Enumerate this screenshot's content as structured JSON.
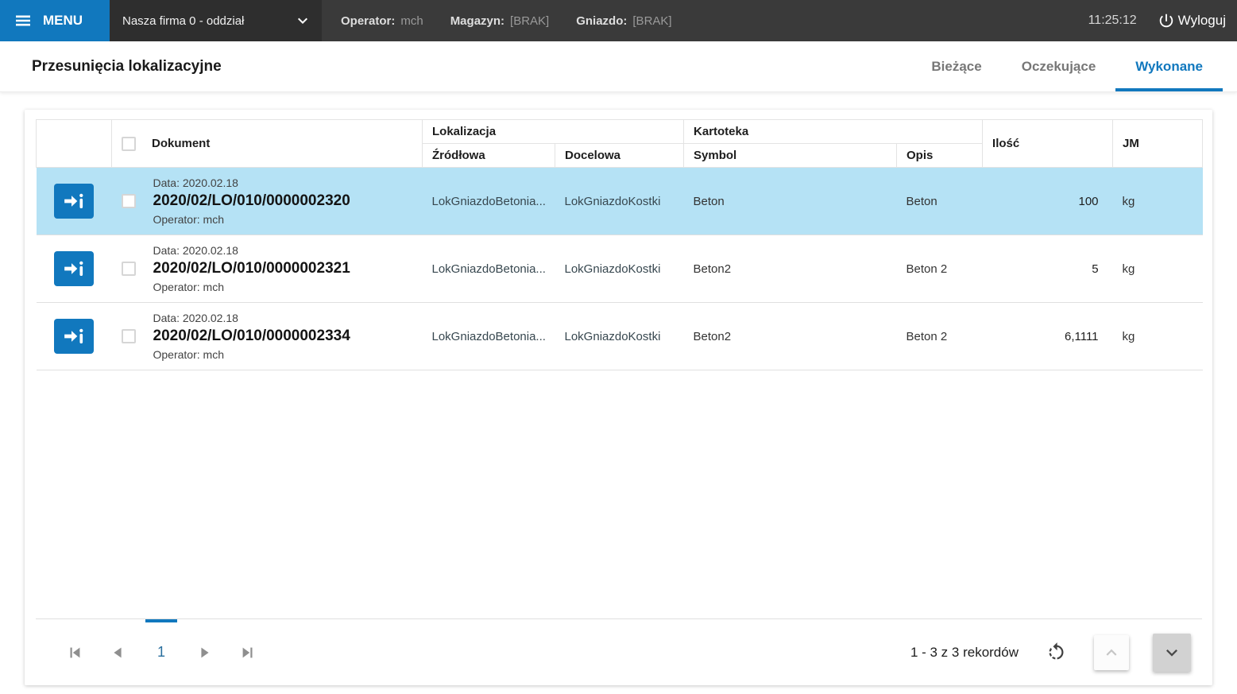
{
  "topbar": {
    "menu_label": "MENU",
    "company": "Nasza firma 0 - oddział",
    "operator_label": "Operator:",
    "operator_value": "mch",
    "magazyn_label": "Magazyn:",
    "magazyn_value": "[BRAK]",
    "gniazdo_label": "Gniazdo:",
    "gniazdo_value": "[BRAK]",
    "time": "11:25:12",
    "logout_label": "Wyloguj"
  },
  "header": {
    "title": "Przesunięcia lokalizacyjne",
    "tabs": [
      {
        "label": "Bieżące",
        "active": false
      },
      {
        "label": "Oczekujące",
        "active": false
      },
      {
        "label": "Wykonane",
        "active": true
      }
    ]
  },
  "table": {
    "headers": {
      "dokument": "Dokument",
      "lokalizacja": "Lokalizacja",
      "zrodlowa": "Źródłowa",
      "docelowa": "Docelowa",
      "kartoteka": "Kartoteka",
      "symbol": "Symbol",
      "opis": "Opis",
      "ilosc": "Ilość",
      "jm": "JM"
    },
    "rows": [
      {
        "date_line": "Data: 2020.02.18",
        "document": "2020/02/LO/010/0000002320",
        "operator_line": "Operator: mch",
        "zrodlowa": "LokGniazdoBetonia...",
        "docelowa": "LokGniazdoKostki",
        "symbol": "Beton",
        "opis": "Beton",
        "ilosc": "100",
        "jm": "kg",
        "selected": true
      },
      {
        "date_line": "Data: 2020.02.18",
        "document": "2020/02/LO/010/0000002321",
        "operator_line": "Operator: mch",
        "zrodlowa": "LokGniazdoBetonia...",
        "docelowa": "LokGniazdoKostki",
        "symbol": "Beton2",
        "opis": "Beton 2",
        "ilosc": "5",
        "jm": "kg",
        "selected": false
      },
      {
        "date_line": "Data: 2020.02.18",
        "document": "2020/02/LO/010/0000002334",
        "operator_line": "Operator: mch",
        "zrodlowa": "LokGniazdoBetonia...",
        "docelowa": "LokGniazdoKostki",
        "symbol": "Beton2",
        "opis": "Beton 2",
        "ilosc": "6,1111",
        "jm": "kg",
        "selected": false
      }
    ]
  },
  "pagination": {
    "page": "1",
    "records": "1 - 3 z 3 rekordów"
  },
  "colors": {
    "accent": "#1178be",
    "selected_row": "#b5e2f5",
    "topbar_bg": "#3a3a3a"
  }
}
